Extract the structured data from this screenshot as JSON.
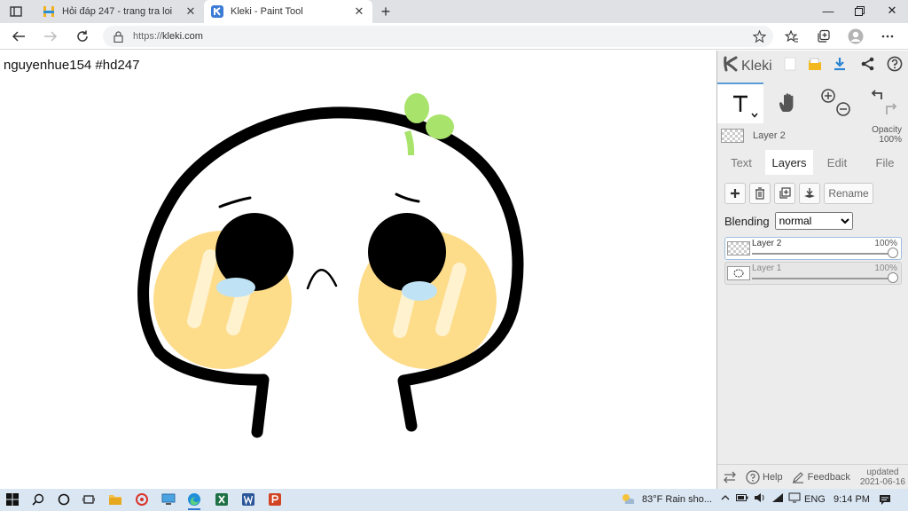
{
  "browser": {
    "tabs": [
      {
        "title": "Hỏi đáp 247 - trang tra loi",
        "active": false,
        "favicon": "hoidap247-icon"
      },
      {
        "title": "Kleki - Paint Tool",
        "active": true,
        "favicon": "kleki-icon"
      }
    ],
    "new_tab_label": "+",
    "address": {
      "scheme": "https://",
      "host": "kleki.com"
    }
  },
  "canvas": {
    "caption": "nguyenhue154 #hd247",
    "colors": {
      "stroke": "#000000",
      "blush": "#fddc8a",
      "sprout": "#a8e36b",
      "tear": "#bfe3f5"
    }
  },
  "kleki": {
    "logo_text": "Kleki",
    "active_layer_name": "Layer 2",
    "opacity_label": "Opacity",
    "opacity_value": "100%",
    "tabs": [
      "Text",
      "Layers",
      "Edit",
      "File"
    ],
    "active_tab": "Layers",
    "rename_label": "Rename",
    "blending_label": "Blending",
    "blending_value": "normal",
    "layers": [
      {
        "name": "Layer 2",
        "opacity": "100%",
        "selected": true
      },
      {
        "name": "Layer 1",
        "opacity": "100%",
        "selected": false
      }
    ],
    "footer": {
      "help": "Help",
      "feedback": "Feedback",
      "updated_label": "updated",
      "updated_date": "2021-06-16"
    }
  },
  "taskbar": {
    "weather": "83°F  Rain sho...",
    "language": "ENG",
    "time": "9:14 PM"
  }
}
